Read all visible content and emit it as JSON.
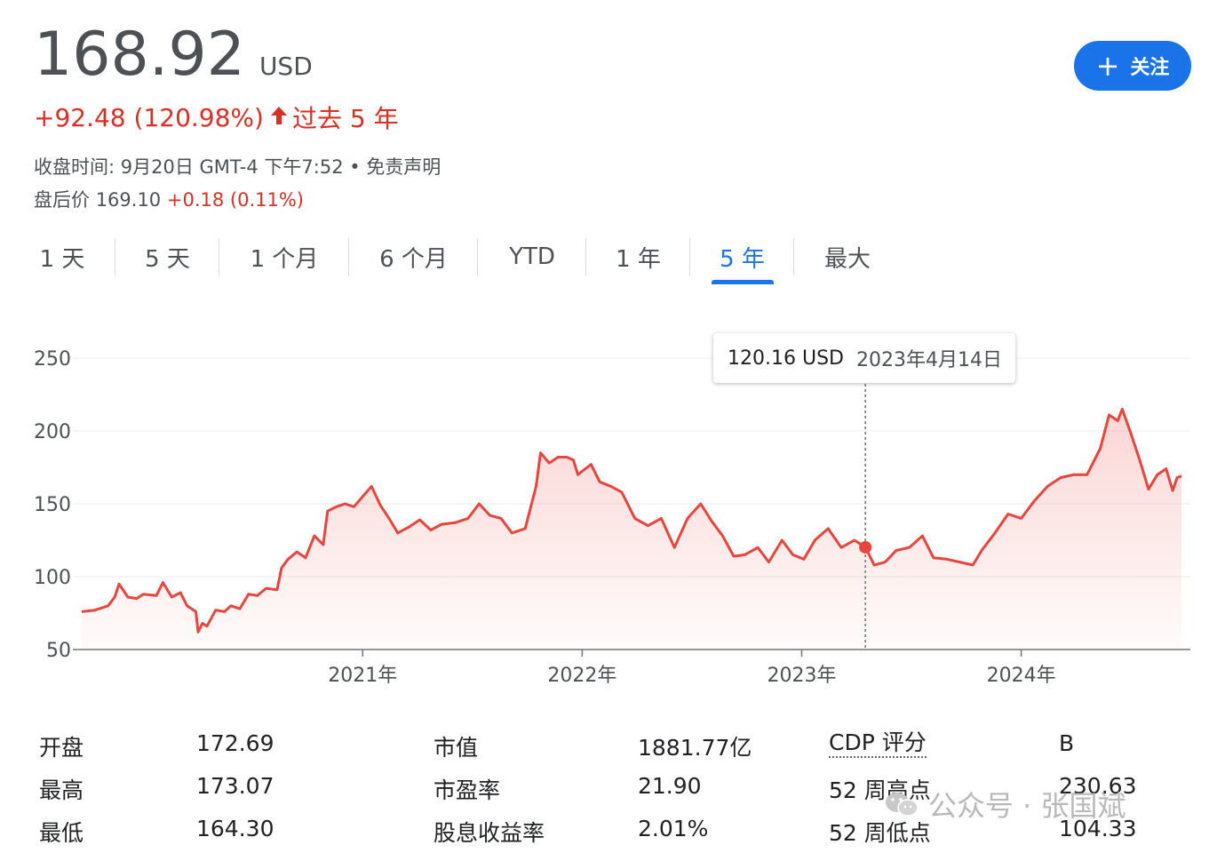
{
  "quote": {
    "price": "168.92",
    "currency": "USD",
    "change": "+92.48 (120.98%)",
    "period": "过去 5 年",
    "close_time": "收盘时间: 9月20日 GMT-4 下午7:52 • 免责声明",
    "after_hours_label": "盘后价",
    "after_hours_price": "169.10",
    "after_hours_change": "+0.18 (0.11%)"
  },
  "follow_button": {
    "label": "关注"
  },
  "tabs": [
    {
      "label": "1 天"
    },
    {
      "label": "5 天"
    },
    {
      "label": "1 个月"
    },
    {
      "label": "6 个月"
    },
    {
      "label": "YTD"
    },
    {
      "label": "1 年"
    },
    {
      "label": "5 年",
      "active": true
    },
    {
      "label": "最大"
    }
  ],
  "tooltip": {
    "value": "120.16 USD",
    "date": "2023年4月14日"
  },
  "chart_data": {
    "type": "area",
    "y_ticks": [
      50,
      100,
      150,
      200,
      250
    ],
    "ylim": [
      50,
      250
    ],
    "x_ticks": [
      "2021年",
      "2022年",
      "2023年",
      "2024年"
    ],
    "xlim": [
      2019.72,
      2024.73
    ],
    "grid": true,
    "color": "#e8453c",
    "marker": {
      "x": 2023.29,
      "y": 120.16
    },
    "series": [
      {
        "x": 2019.72,
        "y": 76
      },
      {
        "x": 2019.78,
        "y": 77
      },
      {
        "x": 2019.84,
        "y": 80
      },
      {
        "x": 2019.87,
        "y": 86
      },
      {
        "x": 2019.89,
        "y": 95
      },
      {
        "x": 2019.93,
        "y": 86
      },
      {
        "x": 2019.97,
        "y": 85
      },
      {
        "x": 2020.0,
        "y": 88
      },
      {
        "x": 2020.06,
        "y": 87
      },
      {
        "x": 2020.09,
        "y": 96
      },
      {
        "x": 2020.13,
        "y": 86
      },
      {
        "x": 2020.17,
        "y": 89
      },
      {
        "x": 2020.2,
        "y": 80
      },
      {
        "x": 2020.24,
        "y": 76
      },
      {
        "x": 2020.25,
        "y": 62
      },
      {
        "x": 2020.27,
        "y": 68
      },
      {
        "x": 2020.29,
        "y": 66
      },
      {
        "x": 2020.33,
        "y": 77
      },
      {
        "x": 2020.37,
        "y": 76
      },
      {
        "x": 2020.4,
        "y": 80
      },
      {
        "x": 2020.44,
        "y": 78
      },
      {
        "x": 2020.48,
        "y": 88
      },
      {
        "x": 2020.52,
        "y": 87
      },
      {
        "x": 2020.56,
        "y": 92
      },
      {
        "x": 2020.61,
        "y": 91
      },
      {
        "x": 2020.63,
        "y": 106
      },
      {
        "x": 2020.66,
        "y": 112
      },
      {
        "x": 2020.7,
        "y": 117
      },
      {
        "x": 2020.74,
        "y": 113
      },
      {
        "x": 2020.78,
        "y": 128
      },
      {
        "x": 2020.82,
        "y": 122
      },
      {
        "x": 2020.84,
        "y": 145
      },
      {
        "x": 2020.88,
        "y": 148
      },
      {
        "x": 2020.92,
        "y": 150
      },
      {
        "x": 2020.96,
        "y": 148
      },
      {
        "x": 2021.0,
        "y": 155
      },
      {
        "x": 2021.04,
        "y": 162
      },
      {
        "x": 2021.08,
        "y": 149
      },
      {
        "x": 2021.12,
        "y": 140
      },
      {
        "x": 2021.16,
        "y": 130
      },
      {
        "x": 2021.21,
        "y": 134
      },
      {
        "x": 2021.26,
        "y": 139
      },
      {
        "x": 2021.31,
        "y": 132
      },
      {
        "x": 2021.36,
        "y": 136
      },
      {
        "x": 2021.42,
        "y": 137
      },
      {
        "x": 2021.48,
        "y": 140
      },
      {
        "x": 2021.53,
        "y": 150
      },
      {
        "x": 2021.58,
        "y": 142
      },
      {
        "x": 2021.63,
        "y": 140
      },
      {
        "x": 2021.68,
        "y": 130
      },
      {
        "x": 2021.74,
        "y": 133
      },
      {
        "x": 2021.79,
        "y": 162
      },
      {
        "x": 2021.81,
        "y": 185
      },
      {
        "x": 2021.85,
        "y": 178
      },
      {
        "x": 2021.89,
        "y": 182
      },
      {
        "x": 2021.93,
        "y": 182
      },
      {
        "x": 2021.96,
        "y": 180
      },
      {
        "x": 2021.98,
        "y": 170
      },
      {
        "x": 2022.04,
        "y": 177
      },
      {
        "x": 2022.08,
        "y": 165
      },
      {
        "x": 2022.13,
        "y": 162
      },
      {
        "x": 2022.18,
        "y": 158
      },
      {
        "x": 2022.24,
        "y": 140
      },
      {
        "x": 2022.3,
        "y": 135
      },
      {
        "x": 2022.36,
        "y": 140
      },
      {
        "x": 2022.42,
        "y": 120
      },
      {
        "x": 2022.48,
        "y": 140
      },
      {
        "x": 2022.54,
        "y": 150
      },
      {
        "x": 2022.59,
        "y": 138
      },
      {
        "x": 2022.64,
        "y": 128
      },
      {
        "x": 2022.69,
        "y": 114
      },
      {
        "x": 2022.74,
        "y": 115
      },
      {
        "x": 2022.8,
        "y": 120
      },
      {
        "x": 2022.85,
        "y": 110
      },
      {
        "x": 2022.91,
        "y": 125
      },
      {
        "x": 2022.96,
        "y": 115
      },
      {
        "x": 2023.01,
        "y": 112
      },
      {
        "x": 2023.06,
        "y": 125
      },
      {
        "x": 2023.12,
        "y": 133
      },
      {
        "x": 2023.18,
        "y": 120
      },
      {
        "x": 2023.24,
        "y": 125
      },
      {
        "x": 2023.29,
        "y": 120.16
      },
      {
        "x": 2023.33,
        "y": 108
      },
      {
        "x": 2023.38,
        "y": 110
      },
      {
        "x": 2023.43,
        "y": 118
      },
      {
        "x": 2023.49,
        "y": 120
      },
      {
        "x": 2023.55,
        "y": 128
      },
      {
        "x": 2023.6,
        "y": 113
      },
      {
        "x": 2023.66,
        "y": 112
      },
      {
        "x": 2023.72,
        "y": 110
      },
      {
        "x": 2023.78,
        "y": 108
      },
      {
        "x": 2023.82,
        "y": 118
      },
      {
        "x": 2023.88,
        "y": 130
      },
      {
        "x": 2023.94,
        "y": 143
      },
      {
        "x": 2024.0,
        "y": 140
      },
      {
        "x": 2024.06,
        "y": 152
      },
      {
        "x": 2024.12,
        "y": 162
      },
      {
        "x": 2024.18,
        "y": 168
      },
      {
        "x": 2024.24,
        "y": 170
      },
      {
        "x": 2024.3,
        "y": 170
      },
      {
        "x": 2024.36,
        "y": 188
      },
      {
        "x": 2024.4,
        "y": 211
      },
      {
        "x": 2024.44,
        "y": 207
      },
      {
        "x": 2024.46,
        "y": 215
      },
      {
        "x": 2024.5,
        "y": 198
      },
      {
        "x": 2024.54,
        "y": 180
      },
      {
        "x": 2024.58,
        "y": 160
      },
      {
        "x": 2024.62,
        "y": 170
      },
      {
        "x": 2024.66,
        "y": 174
      },
      {
        "x": 2024.69,
        "y": 159
      },
      {
        "x": 2024.71,
        "y": 168
      },
      {
        "x": 2024.73,
        "y": 169
      }
    ]
  },
  "stats": [
    [
      {
        "label": "开盘",
        "value": "172.69"
      },
      {
        "label": "最高",
        "value": "173.07"
      },
      {
        "label": "最低",
        "value": "164.30"
      }
    ],
    [
      {
        "label": "市值",
        "value": "1881.77亿"
      },
      {
        "label": "市盈率",
        "value": "21.90"
      },
      {
        "label": "股息收益率",
        "value": "2.01%"
      }
    ],
    [
      {
        "label": "CDP 评分",
        "value": "B"
      },
      {
        "label": "52 周高点",
        "value": "230.63"
      },
      {
        "label": "52 周低点",
        "value": "104.33"
      }
    ]
  ],
  "watermark": {
    "text": "公众号 · 张国斌"
  }
}
